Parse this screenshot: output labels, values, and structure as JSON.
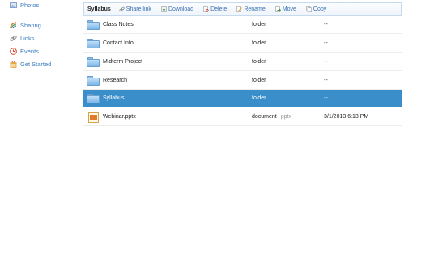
{
  "sidebar": {
    "items": [
      {
        "label": "Photos",
        "icon": "photos-icon",
        "color": "#6b8fc6"
      },
      {
        "label": "Sharing",
        "icon": "sharing-icon",
        "color": "#e07a3a"
      },
      {
        "label": "Links",
        "icon": "links-icon",
        "color": "#8a8a8a"
      },
      {
        "label": "Events",
        "icon": "events-icon",
        "color": "#d9412b"
      },
      {
        "label": "Get Started",
        "icon": "get-started-icon",
        "color": "#e8a33a"
      }
    ]
  },
  "toolbar": {
    "title": "Syllabus",
    "actions": [
      {
        "label": "Share link",
        "icon": "share-link-icon"
      },
      {
        "label": "Download",
        "icon": "download-icon"
      },
      {
        "label": "Delete",
        "icon": "delete-icon"
      },
      {
        "label": "Rename",
        "icon": "rename-icon"
      },
      {
        "label": "Move",
        "icon": "move-icon"
      },
      {
        "label": "Copy",
        "icon": "copy-icon"
      }
    ]
  },
  "files": [
    {
      "name": "Class Notes",
      "type": "folder",
      "ext": "",
      "modified": "--",
      "icon": "folder-icon",
      "selected": false
    },
    {
      "name": "Contact Info",
      "type": "folder",
      "ext": "",
      "modified": "--",
      "icon": "folder-icon",
      "selected": false
    },
    {
      "name": "Midterm Project",
      "type": "folder",
      "ext": "",
      "modified": "--",
      "icon": "folder-icon",
      "selected": false
    },
    {
      "name": "Research",
      "type": "folder",
      "ext": "",
      "modified": "--",
      "icon": "folder-icon",
      "selected": false
    },
    {
      "name": "Syllabus",
      "type": "folder",
      "ext": "",
      "modified": "--",
      "icon": "folder-icon",
      "selected": true
    },
    {
      "name": "Webinar.pptx",
      "type": "document",
      "ext": "pptx",
      "modified": "3/1/2013 6:13 PM",
      "icon": "pptx-file-icon",
      "selected": false
    }
  ],
  "colors": {
    "accent": "#3b7bbf",
    "selection": "#3a8ec9",
    "toolbar_border": "#c7d9ec"
  }
}
